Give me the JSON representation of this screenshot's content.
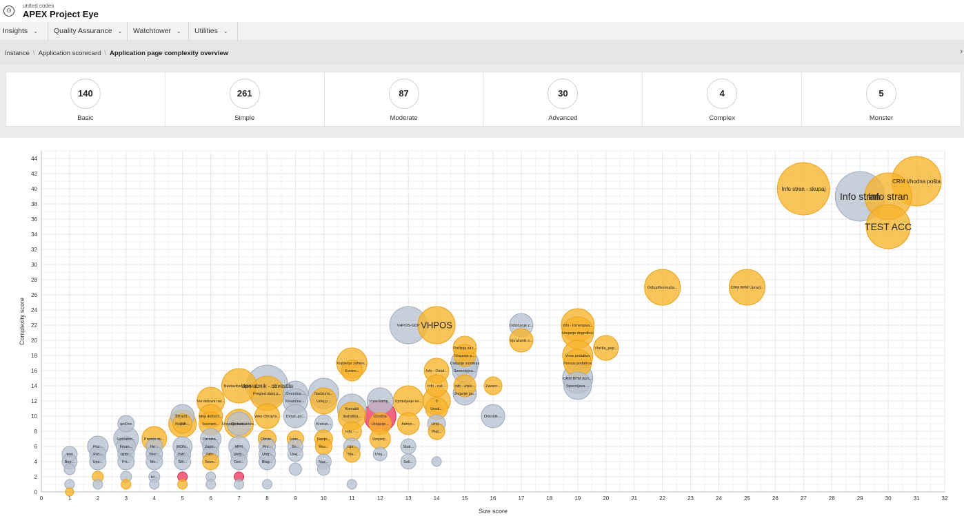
{
  "app": {
    "brand_small": "united codes",
    "brand": "APEX Project Eye",
    "logo_glyph": "⊙"
  },
  "menu": [
    {
      "label": "Insights"
    },
    {
      "label": "Quality Assurance"
    },
    {
      "label": "Watchtower"
    },
    {
      "label": "Utilities"
    }
  ],
  "breadcrumb": {
    "items": [
      "Instance",
      "Application scorecard"
    ],
    "current": "Application page complexity overview",
    "close": "›"
  },
  "stats": [
    {
      "value": "140",
      "label": "Basic"
    },
    {
      "value": "261",
      "label": "Simple"
    },
    {
      "value": "87",
      "label": "Moderate"
    },
    {
      "value": "30",
      "label": "Advanced"
    },
    {
      "value": "4",
      "label": "Complex"
    },
    {
      "value": "5",
      "label": "Monster"
    }
  ],
  "colors": {
    "orange": "#f7b32b",
    "grey": "#b7c1cf",
    "red": "#ec3a5f",
    "accent": "#f2f2f2"
  },
  "chart_data": {
    "type": "scatter",
    "xlabel": "Size score",
    "ylabel": "Complexity score",
    "xlim": [
      0,
      32
    ],
    "ylim": [
      0,
      45
    ],
    "xticks": [
      0,
      1,
      2,
      3,
      4,
      5,
      6,
      7,
      8,
      9,
      10,
      11,
      12,
      13,
      14,
      15,
      16,
      17,
      18,
      19,
      20,
      21,
      22,
      23,
      24,
      25,
      26,
      27,
      28,
      29,
      30,
      31,
      32
    ],
    "yticks": [
      0,
      2,
      4,
      6,
      8,
      10,
      12,
      14,
      16,
      18,
      20,
      22,
      24,
      26,
      28,
      30,
      32,
      34,
      36,
      38,
      40,
      42,
      44
    ],
    "points": [
      {
        "x": 27,
        "y": 40,
        "r": 38,
        "c": "orange",
        "label": "Info stran - skupaj"
      },
      {
        "x": 29,
        "y": 39,
        "r": 36,
        "c": "grey",
        "label": "Info stran"
      },
      {
        "x": 30,
        "y": 39,
        "r": 34,
        "c": "orange",
        "label": "Info stran"
      },
      {
        "x": 31,
        "y": 41,
        "r": 36,
        "c": "orange",
        "label": "CRM Vhodna pošta"
      },
      {
        "x": 30,
        "y": 35,
        "r": 32,
        "c": "orange",
        "label": "TEST ACC"
      },
      {
        "x": 22,
        "y": 27,
        "r": 26,
        "c": "orange",
        "label": "Odkupfleximalia..."
      },
      {
        "x": 25,
        "y": 27,
        "r": 26,
        "c": "orange",
        "label": "CRM BPM Upravl..."
      },
      {
        "x": 13,
        "y": 22,
        "r": 27,
        "c": "grey",
        "label": "VHPOS-GDP"
      },
      {
        "x": 14,
        "y": 22,
        "r": 27,
        "c": "orange",
        "label": "VHPOS"
      },
      {
        "x": 17,
        "y": 22,
        "r": 17,
        "c": "grey",
        "label": "Odločanje z..."
      },
      {
        "x": 17,
        "y": 20,
        "r": 17,
        "c": "orange",
        "label": "Vprašanik z..."
      },
      {
        "x": 19,
        "y": 22,
        "r": 24,
        "c": "orange",
        "label": "Info - Izmenjava..."
      },
      {
        "x": 19,
        "y": 21,
        "r": 23,
        "c": "orange",
        "label": "Urejanje dogodkov"
      },
      {
        "x": 20,
        "y": 19,
        "r": 18,
        "c": "orange",
        "label": "Vlačila_pep..."
      },
      {
        "x": 19,
        "y": 18,
        "r": 22,
        "c": "orange",
        "label": "Vnos podatkov"
      },
      {
        "x": 19,
        "y": 17,
        "r": 20,
        "c": "orange",
        "label": "Prenos podatkov"
      },
      {
        "x": 19,
        "y": 15,
        "r": 22,
        "c": "grey",
        "label": "CRM BPM dom..."
      },
      {
        "x": 19,
        "y": 14,
        "r": 20,
        "c": "grey",
        "label": "Spremljava ..."
      },
      {
        "x": 16,
        "y": 10,
        "r": 17,
        "c": "grey",
        "label": "Dnevnik ..."
      },
      {
        "x": 16,
        "y": 14,
        "r": 13,
        "c": "orange",
        "label": "Zavaro..."
      },
      {
        "x": 15,
        "y": 19,
        "r": 17,
        "c": "orange",
        "label": "Prošnja za i..."
      },
      {
        "x": 15,
        "y": 18,
        "r": 16,
        "c": "orange",
        "label": "Urejanje p..."
      },
      {
        "x": 15,
        "y": 17,
        "r": 20,
        "c": "grey",
        "label": "Urejanje sumenja"
      },
      {
        "x": 15,
        "y": 16,
        "r": 18,
        "c": "grey",
        "label": "Samodejna..."
      },
      {
        "x": 15,
        "y": 14,
        "r": 16,
        "c": "orange",
        "label": "Info - izpis..."
      },
      {
        "x": 15,
        "y": 13,
        "r": 17,
        "c": "grey",
        "label": "Urejanje po..."
      },
      {
        "x": 14,
        "y": 16,
        "r": 18,
        "c": "orange",
        "label": "Info - Ostal..."
      },
      {
        "x": 14,
        "y": 14,
        "r": 16,
        "c": "orange",
        "label": "Info - nat..."
      },
      {
        "x": 14,
        "y": 12,
        "r": 20,
        "c": "orange",
        "label": "0"
      },
      {
        "x": 14,
        "y": 11,
        "r": 16,
        "c": "orange",
        "label": "Uredi..."
      },
      {
        "x": 14,
        "y": 9,
        "r": 13,
        "c": "grey",
        "label": "Urej..."
      },
      {
        "x": 14,
        "y": 8,
        "r": 12,
        "c": "orange",
        "label": "Prel..."
      },
      {
        "x": 14,
        "y": 4,
        "r": 7,
        "c": "grey",
        "label": ""
      },
      {
        "x": 13,
        "y": 12,
        "r": 22,
        "c": "orange",
        "label": "Upravljanje ko..."
      },
      {
        "x": 13,
        "y": 9,
        "r": 16,
        "c": "orange",
        "label": "Admin..."
      },
      {
        "x": 13,
        "y": 6,
        "r": 11,
        "c": "grey",
        "label": "Stati..."
      },
      {
        "x": 13,
        "y": 4,
        "r": 11,
        "c": "grey",
        "label": "Seli..."
      },
      {
        "x": 12,
        "y": 12,
        "r": 19,
        "c": "grey",
        "label": "Vnos kamp..."
      },
      {
        "x": 12,
        "y": 10,
        "r": 23,
        "c": "red",
        "label": "Uvodna"
      },
      {
        "x": 12,
        "y": 9,
        "r": 16,
        "c": "orange",
        "label": "Urejanje..."
      },
      {
        "x": 12,
        "y": 7,
        "r": 15,
        "c": "orange",
        "label": "Urejanj..."
      },
      {
        "x": 12,
        "y": 5,
        "r": 10,
        "c": "grey",
        "label": "Urej..."
      },
      {
        "x": 11,
        "y": 17,
        "r": 22,
        "c": "orange",
        "label": "Knjiženje zahtev..."
      },
      {
        "x": 11,
        "y": 16,
        "r": 15,
        "c": "orange",
        "label": "Kontro..."
      },
      {
        "x": 11,
        "y": 11,
        "r": 21,
        "c": "grey",
        "label": "Kontakti"
      },
      {
        "x": 11,
        "y": 10,
        "r": 20,
        "c": "orange",
        "label": "Statistika..."
      },
      {
        "x": 11,
        "y": 8,
        "r": 14,
        "c": "orange",
        "label": "Info - ..."
      },
      {
        "x": 11,
        "y": 6,
        "r": 12,
        "c": "grey",
        "label": "Upr..."
      },
      {
        "x": 11,
        "y": 5,
        "r": 12,
        "c": "orange",
        "label": "Sta..."
      },
      {
        "x": 11,
        "y": 1,
        "r": 7,
        "c": "grey",
        "label": ""
      },
      {
        "x": 10,
        "y": 13,
        "r": 22,
        "c": "grey",
        "label": "Nadzorni..."
      },
      {
        "x": 10,
        "y": 12,
        "r": 19,
        "c": "orange",
        "label": "Urlej p..."
      },
      {
        "x": 10,
        "y": 9,
        "r": 13,
        "c": "grey",
        "label": "Kreiran..."
      },
      {
        "x": 10,
        "y": 7,
        "r": 13,
        "c": "orange",
        "label": "Naspr..."
      },
      {
        "x": 10,
        "y": 6,
        "r": 12,
        "c": "orange",
        "label": "Rez..."
      },
      {
        "x": 10,
        "y": 4,
        "r": 11,
        "c": "grey",
        "label": "Naz..."
      },
      {
        "x": 10,
        "y": 3,
        "r": 9,
        "c": "grey",
        "label": ""
      },
      {
        "x": 9,
        "y": 13,
        "r": 18,
        "c": "grey",
        "label": "Omrežna ..."
      },
      {
        "x": 9,
        "y": 12,
        "r": 18,
        "c": "grey",
        "label": "Finančna ..."
      },
      {
        "x": 9,
        "y": 10,
        "r": 17,
        "c": "grey",
        "label": "Detail_po..."
      },
      {
        "x": 9,
        "y": 7,
        "r": 12,
        "c": "orange",
        "label": "Izrac..."
      },
      {
        "x": 9,
        "y": 6,
        "r": 11,
        "c": "grey",
        "label": "Dr..."
      },
      {
        "x": 9,
        "y": 5,
        "r": 11,
        "c": "grey",
        "label": "Urej..."
      },
      {
        "x": 9,
        "y": 3,
        "r": 9,
        "c": "grey",
        "label": ""
      },
      {
        "x": 8,
        "y": 14,
        "r": 30,
        "c": "grey",
        "label": "Uporabnik - obvestila"
      },
      {
        "x": 8,
        "y": 13,
        "r": 25,
        "c": "orange",
        "label": "Pregled stanj p..."
      },
      {
        "x": 8,
        "y": 10,
        "r": 18,
        "c": "orange",
        "label": "Web Obravni..."
      },
      {
        "x": 8,
        "y": 7,
        "r": 13,
        "c": "orange",
        "label": "Obrav..."
      },
      {
        "x": 8,
        "y": 6,
        "r": 12,
        "c": "grey",
        "label": "Prv..."
      },
      {
        "x": 8,
        "y": 5,
        "r": 12,
        "c": "grey",
        "label": "Urej..."
      },
      {
        "x": 8,
        "y": 4,
        "r": 12,
        "c": "grey",
        "label": "Blag..."
      },
      {
        "x": 8,
        "y": 1,
        "r": 7,
        "c": "grey",
        "label": ""
      },
      {
        "x": 7,
        "y": 14,
        "r": 25,
        "c": "orange",
        "label": "Nastavitve Apex..."
      },
      {
        "x": 7,
        "y": 9,
        "r": 21,
        "c": "orange",
        "label": "Urejanje kontaktov..."
      },
      {
        "x": 7,
        "y": 9,
        "r": 17,
        "c": "grey",
        "label": "Globaln..."
      },
      {
        "x": 7,
        "y": 6,
        "r": 15,
        "c": "grey",
        "label": "MFK"
      },
      {
        "x": 7,
        "y": 5,
        "r": 12,
        "c": "grey",
        "label": "Uvoj..."
      },
      {
        "x": 7,
        "y": 4,
        "r": 12,
        "c": "grey",
        "label": "Geo..."
      },
      {
        "x": 7,
        "y": 2,
        "r": 7,
        "c": "red",
        "label": ""
      },
      {
        "x": 7,
        "y": 1,
        "r": 7,
        "c": "grey",
        "label": ""
      },
      {
        "x": 6,
        "y": 12,
        "r": 20,
        "c": "orange",
        "label": "Vsi delovni nal..."
      },
      {
        "x": 6,
        "y": 10,
        "r": 17,
        "c": "orange",
        "label": "Moji delovni..."
      },
      {
        "x": 6,
        "y": 9,
        "r": 17,
        "c": "orange",
        "label": "Seznam..."
      },
      {
        "x": 6,
        "y": 7,
        "r": 15,
        "c": "grey",
        "label": "Oznaka..."
      },
      {
        "x": 6,
        "y": 6,
        "r": 12,
        "c": "grey",
        "label": "Zapo..."
      },
      {
        "x": 6,
        "y": 5,
        "r": 12,
        "c": "grey",
        "label": "Zahi..."
      },
      {
        "x": 6,
        "y": 4,
        "r": 12,
        "c": "orange",
        "label": "Sezn..."
      },
      {
        "x": 6,
        "y": 2,
        "r": 7,
        "c": "grey",
        "label": ""
      },
      {
        "x": 6,
        "y": 1,
        "r": 7,
        "c": "grey",
        "label": ""
      },
      {
        "x": 5,
        "y": 10,
        "r": 17,
        "c": "grey",
        "label": "Šifranti..."
      },
      {
        "x": 5,
        "y": 9,
        "r": 20,
        "c": "orange",
        "label": "EV"
      },
      {
        "x": 5,
        "y": 9,
        "r": 14,
        "c": "orange",
        "label": "Report..."
      },
      {
        "x": 5,
        "y": 6,
        "r": 14,
        "c": "grey",
        "label": "IKON..."
      },
      {
        "x": 5,
        "y": 5,
        "r": 12,
        "c": "grey",
        "label": "Zah..."
      },
      {
        "x": 5,
        "y": 4,
        "r": 12,
        "c": "grey",
        "label": "Šifr..."
      },
      {
        "x": 5,
        "y": 2,
        "r": 7,
        "c": "red",
        "label": ""
      },
      {
        "x": 5,
        "y": 1,
        "r": 7,
        "c": "orange",
        "label": ""
      },
      {
        "x": 4,
        "y": 7,
        "r": 18,
        "c": "orange",
        "label": "Prenos do..."
      },
      {
        "x": 4,
        "y": 6,
        "r": 12,
        "c": "grey",
        "label": "Ne..."
      },
      {
        "x": 4,
        "y": 5,
        "r": 12,
        "c": "grey",
        "label": "Sloc..."
      },
      {
        "x": 4,
        "y": 4,
        "r": 12,
        "c": "grey",
        "label": "Me..."
      },
      {
        "x": 4,
        "y": 2,
        "r": 8,
        "c": "grey",
        "label": "Izl..."
      },
      {
        "x": 4,
        "y": 1,
        "r": 7,
        "c": "grey",
        "label": ""
      },
      {
        "x": 3,
        "y": 9,
        "r": 12,
        "c": "grey",
        "label": "getDoc"
      },
      {
        "x": 3,
        "y": 7,
        "r": 18,
        "c": "grey",
        "label": "Uporabni..."
      },
      {
        "x": 3,
        "y": 6,
        "r": 14,
        "c": "grey",
        "label": "Finan..."
      },
      {
        "x": 3,
        "y": 5,
        "r": 12,
        "c": "grey",
        "label": "Izpis..."
      },
      {
        "x": 3,
        "y": 4,
        "r": 12,
        "c": "grey",
        "label": "Pri..."
      },
      {
        "x": 3,
        "y": 2,
        "r": 8,
        "c": "grey",
        "label": ""
      },
      {
        "x": 3,
        "y": 1,
        "r": 7,
        "c": "orange",
        "label": ""
      },
      {
        "x": 2,
        "y": 6,
        "r": 15,
        "c": "grey",
        "label": "Poz..."
      },
      {
        "x": 2,
        "y": 5,
        "r": 12,
        "c": "grey",
        "label": "Pro..."
      },
      {
        "x": 2,
        "y": 4,
        "r": 12,
        "c": "grey",
        "label": "Upo..."
      },
      {
        "x": 2,
        "y": 2,
        "r": 8,
        "c": "orange",
        "label": ""
      },
      {
        "x": 2,
        "y": 1,
        "r": 7,
        "c": "grey",
        "label": ""
      },
      {
        "x": 1,
        "y": 5,
        "r": 11,
        "c": "grey",
        "label": "test"
      },
      {
        "x": 1,
        "y": 4,
        "r": 11,
        "c": "grey",
        "label": "Bep..."
      },
      {
        "x": 1,
        "y": 3,
        "r": 8,
        "c": "grey",
        "label": ""
      },
      {
        "x": 1,
        "y": 1,
        "r": 7,
        "c": "grey",
        "label": ""
      },
      {
        "x": 1,
        "y": 0,
        "r": 6,
        "c": "orange",
        "label": ""
      }
    ]
  }
}
